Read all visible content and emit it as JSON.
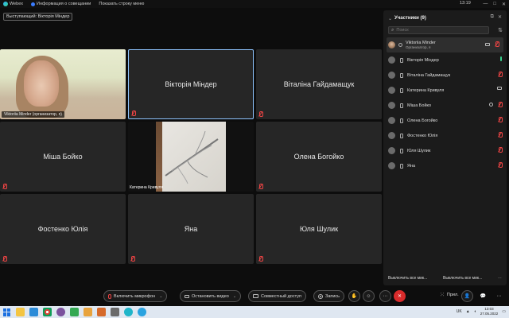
{
  "titlebar": {
    "app": "Webex",
    "info": "Информация о совещании",
    "show_menu": "Показать строку меню",
    "time": "13:19"
  },
  "speaker": "Выступающий: Вікторія Міндер",
  "tiles": [
    {
      "type": "camera",
      "label": "Viktoriia Minder (организатор, я)"
    },
    {
      "type": "name",
      "name": "Вікторія Міндер",
      "active": true
    },
    {
      "type": "name",
      "name": "Віталіна Гайдамащук"
    },
    {
      "type": "name",
      "name": "Міша Бойко"
    },
    {
      "type": "share",
      "label": "Катерина Кривуля"
    },
    {
      "type": "name",
      "name": "Олена Богойко"
    },
    {
      "type": "name",
      "name": "Фостенко Юлія"
    },
    {
      "type": "name",
      "name": "Яна"
    },
    {
      "type": "name",
      "name": "Юля Шулик"
    }
  ],
  "panel": {
    "title": "Участники (9)",
    "search_placeholder": "Поиск",
    "participants": [
      {
        "name": "Viktoriia Minder",
        "sub": "Организатор, я",
        "host": true,
        "icons": [
          "cam",
          "mic-off"
        ]
      },
      {
        "name": "Вікторія Міндер",
        "icons": [
          "mic-on"
        ]
      },
      {
        "name": "Віталіна Гайдамащук",
        "icons": [
          "mic-off"
        ]
      },
      {
        "name": "Катерина Кривуля",
        "icons": [
          "cam"
        ]
      },
      {
        "name": "Міша Бойко",
        "icons": [
          "chat",
          "mic-off"
        ]
      },
      {
        "name": "Олена Богойко",
        "icons": [
          "mic-off"
        ]
      },
      {
        "name": "Фостенко Юлія",
        "icons": [
          "mic-off"
        ]
      },
      {
        "name": "Юля Шулик",
        "icons": [
          "mic-off"
        ]
      },
      {
        "name": "Яна",
        "icons": [
          "mic-off"
        ]
      }
    ],
    "footer_left": "Выключить все мик...",
    "footer_right": "Выключить все мик..."
  },
  "toolbar": {
    "mic": "Включить микрофон",
    "video": "Остановить видео",
    "share": "Совместный доступ",
    "record": "Запись",
    "apps": "Прил."
  },
  "taskbar": {
    "lang": "UK",
    "time": "13:03",
    "date": "27.05.2022"
  },
  "colors": {
    "accent_leave": "#d92b2b",
    "active_border": "#8ec4ff",
    "mic_off": "#e44444",
    "mic_on": "#3ad38f"
  }
}
